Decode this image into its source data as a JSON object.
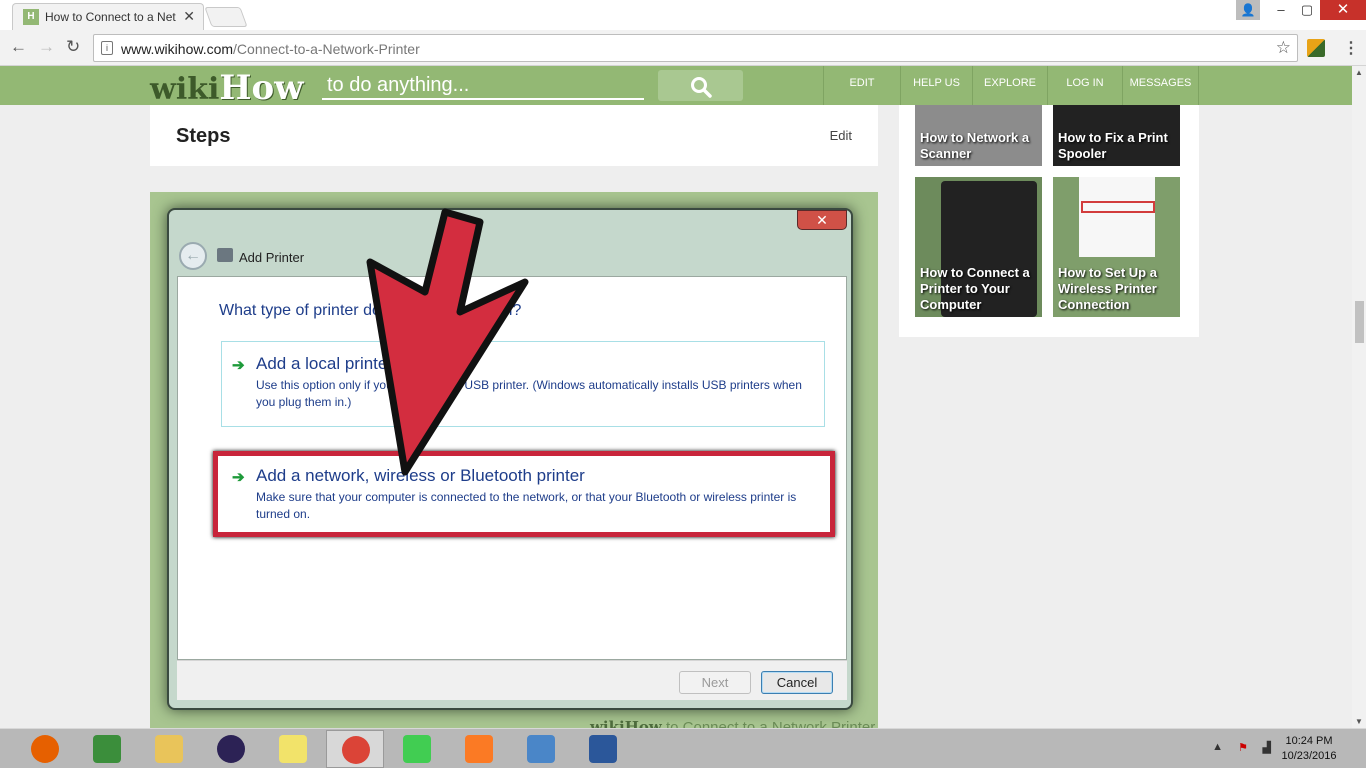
{
  "browser": {
    "tab_title": "How to Connect to a Net",
    "favicon_text": "H",
    "tab_close": "✕",
    "url_domain": "www.wikihow.com",
    "url_path": "/Connect-to-a-Network-Printer",
    "nav": {
      "back": "←",
      "forward": "→",
      "reload": "↻",
      "star": "☆",
      "menu": "⋮"
    },
    "window": {
      "user": "👤",
      "minimize": "–",
      "maximize": "▢",
      "close": "✕"
    }
  },
  "wikihow": {
    "logo_wiki": "wiki",
    "logo_how": "How",
    "search_placeholder": "to do anything...",
    "nav": [
      "EDIT",
      "HELP US",
      "EXPLORE",
      "LOG IN",
      "MESSAGES"
    ],
    "section_title": "Steps",
    "section_edit": "Edit",
    "watermark_brand": "wikiHow",
    "watermark_text": " to Connect to a Network Printer"
  },
  "dialog": {
    "close": "✕",
    "back": "←",
    "title": "Add Printer",
    "question": "What type of printer do you want to install?",
    "option1": {
      "title": "Add a local printer",
      "desc": "Use this option only if you don't have a USB printer. (Windows automatically installs USB printers when you plug them in.)"
    },
    "option2": {
      "title": "Add a network, wireless or Bluetooth printer",
      "desc": "Make sure that your computer is connected to the network, or that your Bluetooth or wireless printer is turned on."
    },
    "next": "Next",
    "cancel": "Cancel",
    "arrow_color": "#d32d3f"
  },
  "related": [
    {
      "label": "How to Network a Scanner"
    },
    {
      "label": "How to Fix a Print Spooler"
    },
    {
      "label": "How to Connect a Printer to Your Computer"
    },
    {
      "label": "How to Set Up a Wireless Printer Connection"
    }
  ],
  "taskbar": {
    "apps": [
      {
        "name": "firefox",
        "color": "#e66000"
      },
      {
        "name": "chart-app",
        "color": "#3b8e3b"
      },
      {
        "name": "file-explorer",
        "color": "#e9c45a"
      },
      {
        "name": "eclipse",
        "color": "#2c2255"
      },
      {
        "name": "sticky-notes",
        "color": "#f2e36a"
      },
      {
        "name": "chrome",
        "color": "#db4437"
      },
      {
        "name": "qt-creator",
        "color": "#41cd52"
      },
      {
        "name": "xampp",
        "color": "#fb7a24"
      },
      {
        "name": "network-settings",
        "color": "#4a86c8"
      },
      {
        "name": "word",
        "color": "#2b579a"
      }
    ],
    "time": "10:24 PM",
    "date": "10/23/2016"
  }
}
